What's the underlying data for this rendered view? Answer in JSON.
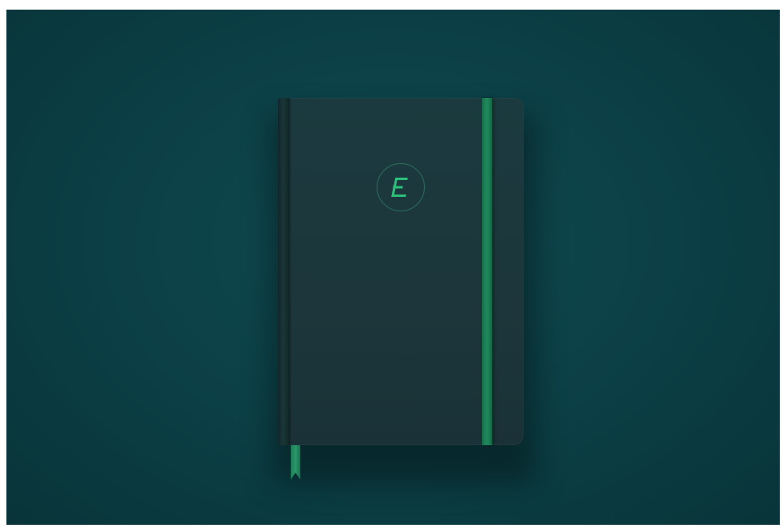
{
  "scene": {
    "background_color": "#0b3f45",
    "notebook_color": "#1c363b",
    "band_color": "#1f8a5c",
    "logo_color": "#2bbf7a",
    "logo_icon": "stylized-e-in-circle-icon"
  }
}
